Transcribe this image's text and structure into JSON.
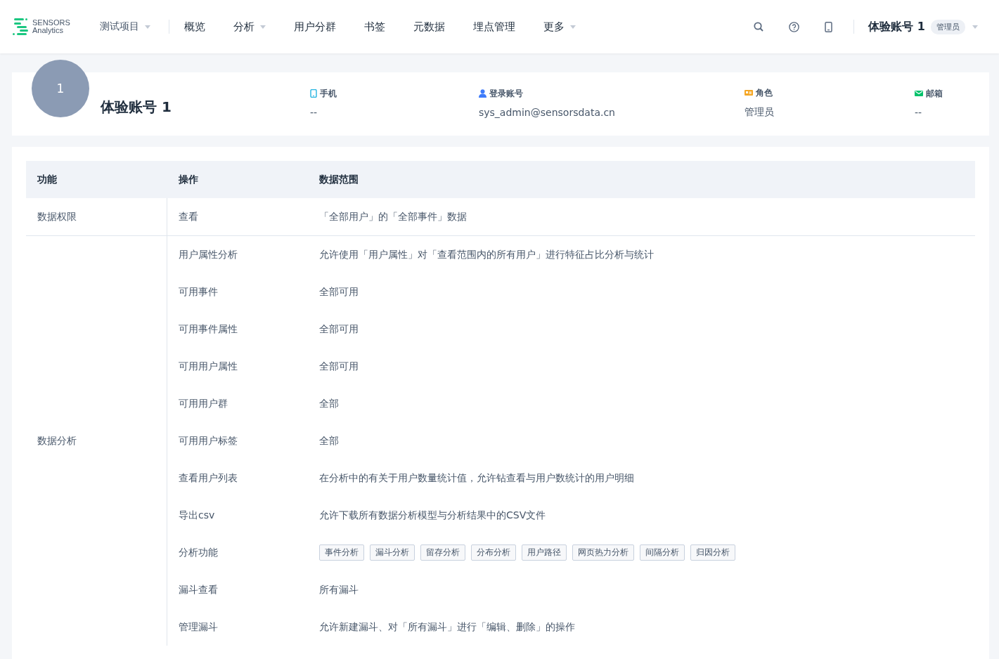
{
  "logo": {
    "line1": "SENSORS",
    "line2": "Analytics"
  },
  "project": {
    "label": "测试项目",
    "dropdown": true
  },
  "nav": [
    {
      "label": "概览",
      "dropdown": false
    },
    {
      "label": "分析",
      "dropdown": true
    },
    {
      "label": "用户分群",
      "dropdown": false
    },
    {
      "label": "书签",
      "dropdown": false
    },
    {
      "label": "元数据",
      "dropdown": false
    },
    {
      "label": "埋点管理",
      "dropdown": false
    },
    {
      "label": "更多",
      "dropdown": true
    }
  ],
  "user_menu": {
    "name": "体验账号 1",
    "role": "管理员"
  },
  "profile": {
    "avatar": "1",
    "name": "体验账号 1",
    "fields": [
      {
        "kind": "phone",
        "label": "手机",
        "value": "--"
      },
      {
        "kind": "account",
        "label": "登录账号",
        "value": "sys_admin@sensorsdata.cn"
      },
      {
        "kind": "role",
        "label": "角色",
        "value": "管理员"
      },
      {
        "kind": "email",
        "label": "邮箱",
        "value": "--"
      }
    ]
  },
  "table": {
    "columns": [
      "功能",
      "操作",
      "数据范围"
    ],
    "groups": [
      {
        "feature": "数据权限",
        "rows": [
          {
            "kind": "text",
            "operation": "查看",
            "scope": "「全部用户」的「全部事件」数据"
          }
        ]
      },
      {
        "feature": "数据分析",
        "rows": [
          {
            "kind": "text",
            "operation": "用户属性分析",
            "scope": "允许使用「用户属性」对「查看范围内的所有用户」进行特征占比分析与统计"
          },
          {
            "kind": "text",
            "operation": "可用事件",
            "scope": "全部可用"
          },
          {
            "kind": "text",
            "operation": "可用事件属性",
            "scope": "全部可用"
          },
          {
            "kind": "text",
            "operation": "可用用户属性",
            "scope": "全部可用"
          },
          {
            "kind": "text",
            "operation": "可用用户群",
            "scope": "全部"
          },
          {
            "kind": "text",
            "operation": "可用用户标签",
            "scope": "全部"
          },
          {
            "kind": "text",
            "operation": "查看用户列表",
            "scope": "在分析中的有关于用户数量统计值，允许钻查看与用户数统计的用户明细"
          },
          {
            "kind": "text",
            "operation": "导出csv",
            "scope": "允许下载所有数据分析模型与分析结果中的CSV文件"
          },
          {
            "kind": "tags",
            "operation": "分析功能",
            "tags": [
              "事件分析",
              "漏斗分析",
              "留存分析",
              "分布分析",
              "用户路径",
              "网页热力分析",
              "间隔分析",
              "归因分析"
            ]
          },
          {
            "kind": "text",
            "operation": "漏斗查看",
            "scope": "所有漏斗"
          },
          {
            "kind": "text",
            "operation": "管理漏斗",
            "scope": "允许新建漏斗、对「所有漏斗」进行「编辑、删除」的操作"
          }
        ]
      }
    ]
  }
}
